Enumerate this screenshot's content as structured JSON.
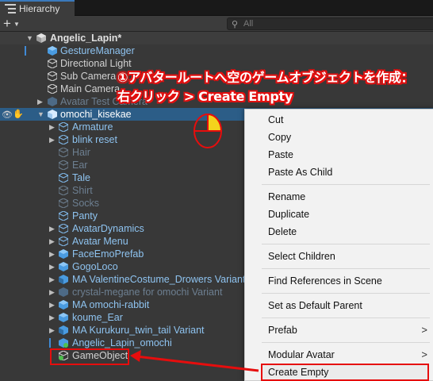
{
  "panel": {
    "title": "Hierarchy"
  },
  "toolbar": {
    "add_symbol": "+",
    "search_placeholder": "All"
  },
  "scene": {
    "name": "Angelic_Lapin*"
  },
  "rows": [
    {
      "label": "GestureManager"
    },
    {
      "label": "Directional Light"
    },
    {
      "label": "Sub Camera"
    },
    {
      "label": "Main Camera"
    },
    {
      "label": "Avatar Test Camera"
    },
    {
      "label": "omochi_kisekae"
    },
    {
      "label": "Armature"
    },
    {
      "label": "blink reset"
    },
    {
      "label": "Hair"
    },
    {
      "label": "Ear"
    },
    {
      "label": "Tale"
    },
    {
      "label": "Shirt"
    },
    {
      "label": "Socks"
    },
    {
      "label": "Panty"
    },
    {
      "label": "AvatarDynamics"
    },
    {
      "label": "Avatar Menu"
    },
    {
      "label": "FaceEmoPrefab"
    },
    {
      "label": "GogoLoco"
    },
    {
      "label": "MA ValentineCostume_Drowers Variant"
    },
    {
      "label": "crystal-megane for omochi Variant"
    },
    {
      "label": "MA omochi-rabbit"
    },
    {
      "label": "koume_Ear"
    },
    {
      "label": "MA Kurukuru_twin_tail Variant"
    },
    {
      "label": "Angelic_Lapin_omochi"
    },
    {
      "label": "GameObject"
    }
  ],
  "menu": {
    "cut": "Cut",
    "copy": "Copy",
    "paste": "Paste",
    "paste_as_child": "Paste As Child",
    "rename": "Rename",
    "duplicate": "Duplicate",
    "delete": "Delete",
    "select_children": "Select Children",
    "find_references": "Find References in Scene",
    "set_default_parent": "Set as Default Parent",
    "prefab": "Prefab",
    "modular_avatar": "Modular Avatar",
    "create_empty": "Create Empty",
    "submenu_chevron": ">"
  },
  "annotation": {
    "line1": "①アバタールートへ空のゲームオブジェクトを作成：",
    "line2": "右クリック > Create Empty"
  },
  "colors": {
    "accent": "#e60d0d",
    "selection": "#2c5d87",
    "prefab_text": "#8ec3f0",
    "annotation_fill": "#ffffff"
  }
}
